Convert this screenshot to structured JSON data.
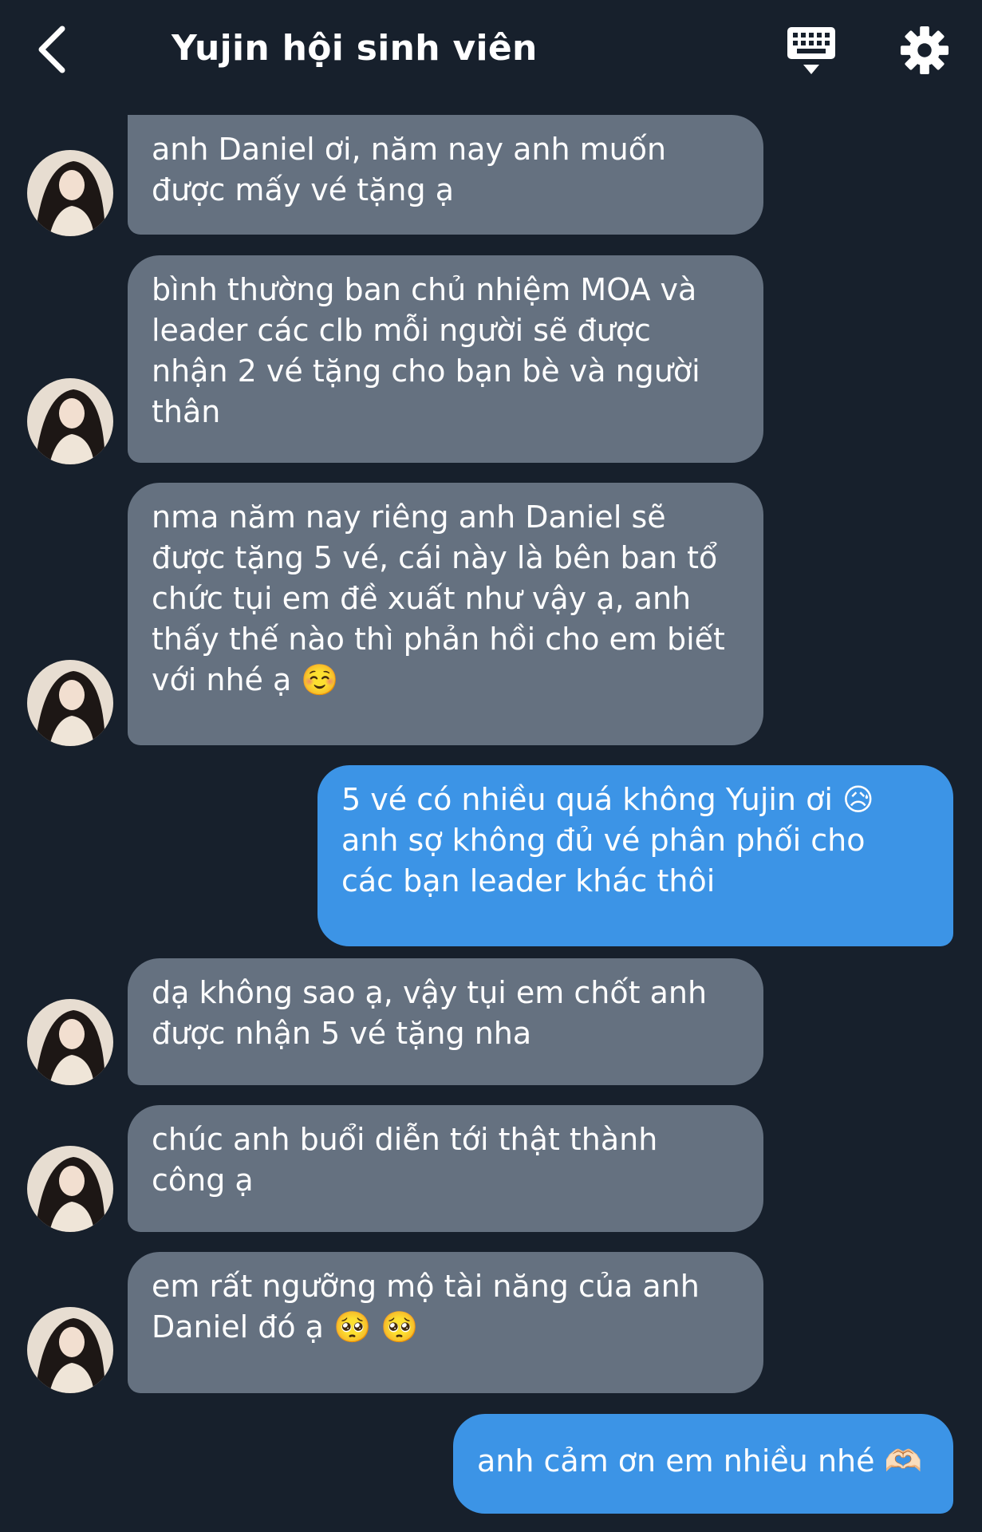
{
  "header": {
    "title": "Yujin hội sinh viên",
    "back_icon": "chevron-left-icon",
    "keyboard_icon": "keyboard-icon",
    "settings_icon": "gear-icon"
  },
  "colors": {
    "background": "#17202c",
    "incoming_bubble": "#657180",
    "outgoing_bubble": "#3c94e6",
    "text": "#ffffff"
  },
  "messages": [
    {
      "sender": "Yujin",
      "direction": "incoming",
      "text": "anh Daniel ơi, năm nay anh muốn\nđược mấy vé tặng ạ"
    },
    {
      "sender": "Yujin",
      "direction": "incoming",
      "text": "bình thường ban chủ nhiệm MOA và\nleader các clb mỗi người sẽ được\nnhận 2 vé tặng cho bạn bè và người\nthân"
    },
    {
      "sender": "Yujin",
      "direction": "incoming",
      "text": "nma năm nay riêng anh Daniel sẽ\nđược tặng 5 vé, cái này là bên ban tổ\nchức tụi em đề xuất như vậy ạ, anh\nthấy thế nào thì phản hồi cho em biết\nvới nhé ạ ☺️"
    },
    {
      "sender": "Daniel",
      "direction": "outgoing",
      "text": "5 vé có nhiều quá không Yujin ơi 😥\nanh sợ không đủ vé phân phối cho\ncác bạn leader khác thôi"
    },
    {
      "sender": "Yujin",
      "direction": "incoming",
      "text": "dạ không sao ạ, vậy tụi em chốt anh\nđược nhận 5 vé tặng nha"
    },
    {
      "sender": "Yujin",
      "direction": "incoming",
      "text": "chúc anh buổi diễn tới thật thành\ncông ạ"
    },
    {
      "sender": "Yujin",
      "direction": "incoming",
      "text": "em rất ngưỡng mộ tài năng của anh\nDaniel đó ạ 🥺 🥺"
    },
    {
      "sender": "Daniel",
      "direction": "outgoing",
      "text": "anh cảm ơn em nhiều nhé 🫶🏻"
    }
  ]
}
